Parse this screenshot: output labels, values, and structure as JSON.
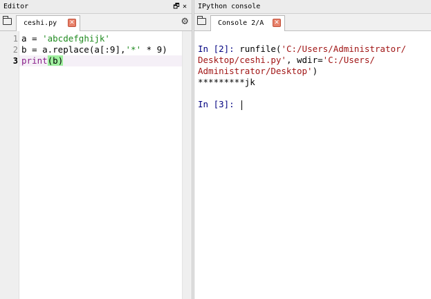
{
  "editor": {
    "title": "Editor",
    "tab_label": "ceshi.py",
    "lines": [
      {
        "num": "1",
        "tokens": [
          {
            "t": "a = ",
            "c": ""
          },
          {
            "t": "'abcdefghijk'",
            "c": "str"
          }
        ]
      },
      {
        "num": "2",
        "tokens": [
          {
            "t": "b = a.replace(a[:9],",
            "c": ""
          },
          {
            "t": "'*'",
            "c": "str"
          },
          {
            "t": " * 9)",
            "c": ""
          }
        ]
      },
      {
        "num": "3",
        "tokens": [
          {
            "t": "print",
            "c": "kw"
          },
          {
            "t": "(b)",
            "c": "hl"
          }
        ]
      }
    ]
  },
  "console": {
    "title": "IPython console",
    "tab_label": "Console 2/A",
    "lines": [
      {
        "tokens": [
          {
            "t": "In [2]: ",
            "c": "prompt"
          },
          {
            "t": "runfile(",
            "c": ""
          },
          {
            "t": "'C:/Users/Administrator/",
            "c": "cstr"
          }
        ]
      },
      {
        "tokens": [
          {
            "t": "Desktop/ceshi.py'",
            "c": "cstr"
          },
          {
            "t": ", wdir=",
            "c": ""
          },
          {
            "t": "'C:/Users/",
            "c": "cstr"
          }
        ]
      },
      {
        "tokens": [
          {
            "t": "Administrator/Desktop'",
            "c": "cstr"
          },
          {
            "t": ")",
            "c": ""
          }
        ]
      },
      {
        "tokens": [
          {
            "t": "*********jk",
            "c": ""
          }
        ]
      },
      {
        "tokens": []
      },
      {
        "tokens": [
          {
            "t": "In [3]: ",
            "c": "prompt"
          }
        ]
      }
    ]
  }
}
